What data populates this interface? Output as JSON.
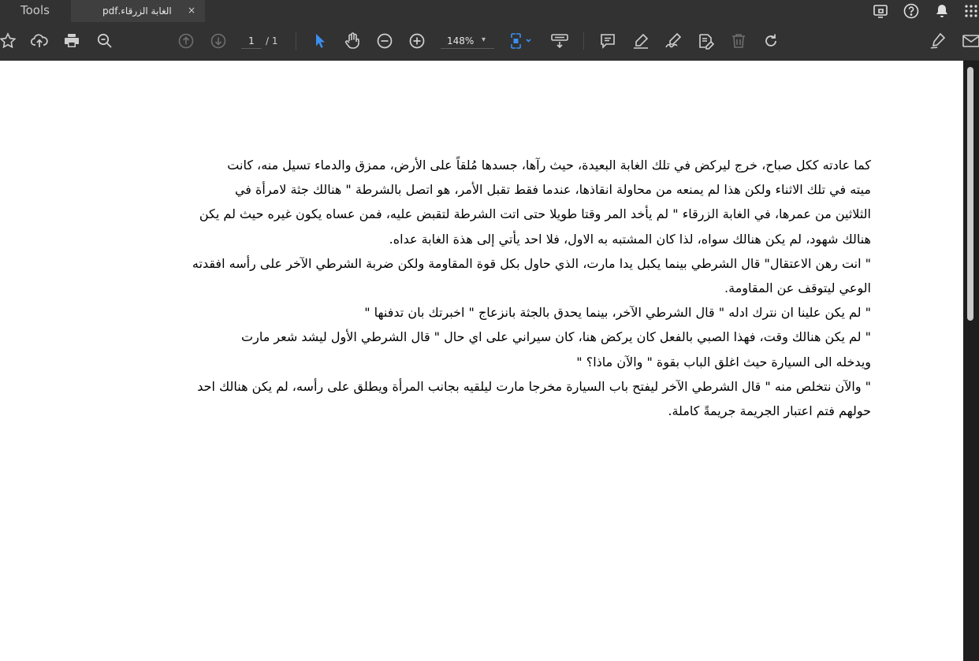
{
  "tabs": {
    "tools_label": "Tools",
    "document_title": "الغابة الزرقاء.pdf",
    "close_glyph": "×"
  },
  "toolbar": {
    "page_current": "1",
    "page_total": "/ 1",
    "zoom_value": "148%",
    "zoom_chevron": "▾"
  },
  "document": {
    "lines": [
      "كما عادته ككل صباح، خرج ليركض في تلك الغابة البعيدة، حيث رآها، جسدها مُلقاً على الأرض، ممزق والدماء تسيل منه، كانت",
      "ميته في تلك الاثناء ولكن هذا لم يمنعه من محاولة انقاذها، عندما فقط تقبل الأمر، هو اتصل بالشرطة \" هنالك جثة لامرأة في",
      "الثلاثين من عمرها، في الغابة الزرقاء \" لم يأخد المر وقتا طويلا حتى اتت الشرطة لتقبض عليه، فمن عساه يكون غيره حيث لم يكن",
      "هنالك شهود، لم يكن هنالك سواه، لذا كان المشتبه به الاول، فلا احد يأتي إلى هذة الغابة عداه.",
      "\" انت رهن الاعتقال\" قال الشرطي بينما يكبل يدا مارت، الذي حاول بكل قوة المقاومة ولكن ضربة الشرطي الآخر على رأسه افقدته",
      "الوعي ليتوقف عن المقاومة.",
      "\" لم يكن علينا ان نترك ادله \" قال الشرطي الآخر، بينما يحدق بالجثة بانزعاج \" اخبرتك بان تدفنها \"",
      "\" لم يكن هنالك وقت، فهذا الصبي بالفعل كان يركض هنا، كان سيراني على اي حال \" قال الشرطي الأول ليشد شعر مارت",
      "ويدخله الى السيارة حيث اغلق الباب بقوة \" والآن ماذا؟ \"",
      "\" والآن نتخلص منه \" قال الشرطي الآخر ليفتح باب السيارة مخرجا مارت ليلقيه بجانب المرأة ويطلق على رأسه، لم يكن هنالك احد",
      "حولهم فتم اعتبار الجريمة جريمةً كاملة."
    ]
  },
  "icons": {
    "toolbar": [
      "star-icon",
      "upload-icon",
      "print-icon",
      "search-icon",
      "page-up-icon",
      "page-down-icon",
      "select-cursor-icon",
      "hand-tool-icon",
      "zoom-out-icon",
      "zoom-in-icon",
      "fit-page-icon",
      "scroll-mode-icon",
      "comment-icon",
      "highlight-icon",
      "sign-icon",
      "edit-pdf-icon",
      "delete-icon",
      "rotate-icon",
      "fill-sign-icon",
      "email-icon"
    ],
    "tabbar": [
      "screen-share-icon",
      "help-icon",
      "notification-bell-icon",
      "apps-grid-icon"
    ]
  },
  "colors": {
    "chrome_bg": "#323232",
    "accent": "#3b8ff0",
    "document_bg": "#ffffff"
  }
}
